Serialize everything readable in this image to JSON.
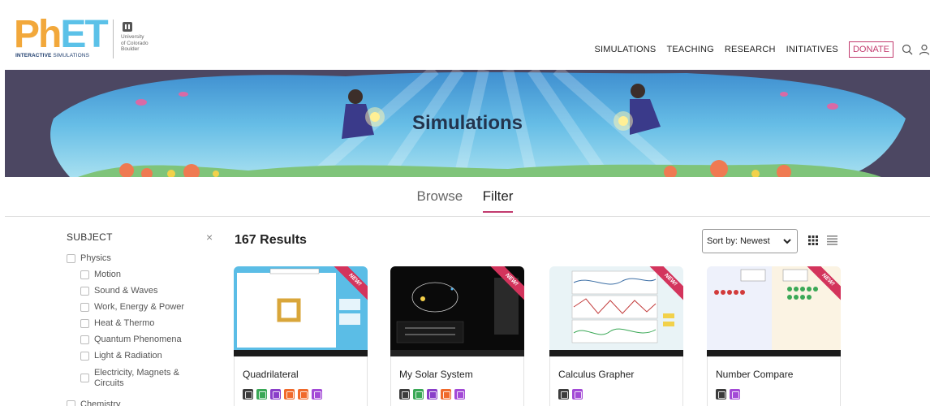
{
  "logo": {
    "letters_ph": "Ph",
    "letters_et": "ET",
    "tagline_bold": "INTERACTIVE",
    "tagline_light": "SIMULATIONS",
    "university": "University\nof Colorado\nBoulder"
  },
  "nav": {
    "items": [
      "SIMULATIONS",
      "TEACHING",
      "RESEARCH",
      "INITIATIVES"
    ],
    "donate": "DONATE",
    "icons": [
      "search-icon",
      "user-icon"
    ]
  },
  "banner": {
    "title": "Simulations"
  },
  "tabs": {
    "browse": "Browse",
    "filter": "Filter",
    "active": "Filter"
  },
  "filters": {
    "heading": "SUBJECT",
    "clear_icon": "close-icon",
    "clear_glyph": "×",
    "items": [
      {
        "label": "Physics",
        "level": 0,
        "checked": false
      },
      {
        "label": "Motion",
        "level": 1,
        "checked": false
      },
      {
        "label": "Sound & Waves",
        "level": 1,
        "checked": false
      },
      {
        "label": "Work, Energy & Power",
        "level": 1,
        "checked": false
      },
      {
        "label": "Heat & Thermo",
        "level": 1,
        "checked": false
      },
      {
        "label": "Quantum Phenomena",
        "level": 1,
        "checked": false
      },
      {
        "label": "Light & Radiation",
        "level": 1,
        "checked": false
      },
      {
        "label": "Electricity, Magnets &\nCircuits",
        "level": 1,
        "checked": false
      },
      {
        "label": "Chemistry",
        "level": 0,
        "checked": false
      }
    ]
  },
  "results": {
    "count_label": "167 Results",
    "sort_label": "Sort by: Newest",
    "view_icons": [
      "grid-view-icon",
      "list-view-icon"
    ]
  },
  "cards": [
    {
      "title": "Quadrilateral",
      "new_label": "NEW!",
      "badges": [
        "html5-icon",
        "green-feature-icon",
        "purple-feature-icon",
        "sound-icon",
        "orange-feature-icon",
        "zoom-icon"
      ],
      "thumb_bg": "#5bbde6"
    },
    {
      "title": "My Solar System",
      "new_label": "NEW!",
      "badges": [
        "html5-icon",
        "green-feature-icon",
        "purple-feature-icon",
        "sound-icon",
        "zoom-icon"
      ],
      "thumb_bg": "#0a0a0a"
    },
    {
      "title": "Calculus Grapher",
      "new_label": "NEW!",
      "badges": [
        "html5-icon",
        "zoom-icon"
      ],
      "thumb_bg": "#e9f3f6"
    },
    {
      "title": "Number Compare",
      "new_label": "NEW!",
      "badges": [
        "html5-icon",
        "zoom-icon"
      ],
      "thumb_bg": "#f5f1e6"
    }
  ],
  "colors": {
    "accent": "#c23b6e",
    "badge_html5": "#3c3c3c",
    "badge_green": "#3aa856",
    "badge_purple": "#8a3fc9",
    "badge_orange": "#f06a2c",
    "badge_zoom": "#a34ad6"
  }
}
